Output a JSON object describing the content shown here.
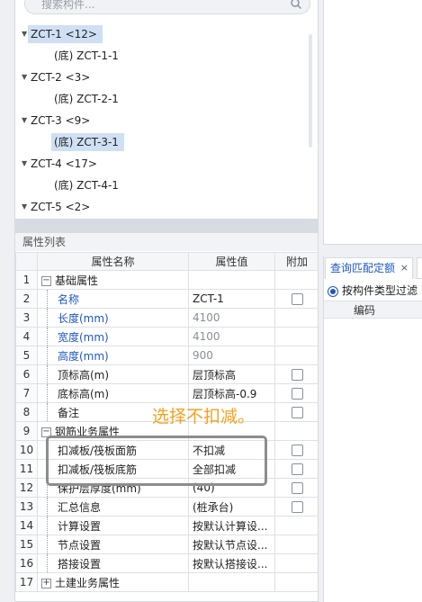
{
  "search": {
    "placeholder": "搜索构件..."
  },
  "tree": {
    "items": [
      {
        "label": "ZCT-1 <12>",
        "kind": "parent",
        "selected": true
      },
      {
        "label": "(底) ZCT-1-1",
        "kind": "child",
        "selected": false
      },
      {
        "label": "ZCT-2 <3>",
        "kind": "parent",
        "selected": false
      },
      {
        "label": "(底) ZCT-2-1",
        "kind": "child",
        "selected": false
      },
      {
        "label": "ZCT-3 <9>",
        "kind": "parent",
        "selected": false
      },
      {
        "label": "(底) ZCT-3-1",
        "kind": "child",
        "selected": true
      },
      {
        "label": "ZCT-4 <17>",
        "kind": "parent",
        "selected": false
      },
      {
        "label": "(底) ZCT-4-1",
        "kind": "child",
        "selected": false
      },
      {
        "label": "ZCT-5 <2>",
        "kind": "parent",
        "selected": false
      }
    ]
  },
  "props": {
    "title": "属性列表",
    "headers": {
      "name": "属性名称",
      "value": "属性值",
      "extra": "附加"
    },
    "rows": [
      {
        "num": "1",
        "name": "基础属性",
        "value": "",
        "group": true,
        "expander": "−"
      },
      {
        "num": "2",
        "name": "名称",
        "value": "ZCT-1",
        "blue": true,
        "check": true
      },
      {
        "num": "3",
        "name": "长度(mm)",
        "value": "4100",
        "blue": true,
        "readonly": true
      },
      {
        "num": "4",
        "name": "宽度(mm)",
        "value": "4100",
        "blue": true,
        "readonly": true
      },
      {
        "num": "5",
        "name": "高度(mm)",
        "value": "900",
        "blue": true,
        "readonly": true
      },
      {
        "num": "6",
        "name": "顶标高(m)",
        "value": "层顶标高",
        "check": true
      },
      {
        "num": "7",
        "name": "底标高(m)",
        "value": "层顶标高-0.9",
        "check": true
      },
      {
        "num": "8",
        "name": "备注",
        "value": "",
        "check": true
      },
      {
        "num": "9",
        "name": "钢筋业务属性",
        "value": "",
        "group": true,
        "expander": "−"
      },
      {
        "num": "10",
        "name": "扣减板/筏板面筋",
        "value": "不扣减",
        "check": true
      },
      {
        "num": "11",
        "name": "扣减板/筏板底筋",
        "value": "全部扣减",
        "check": true
      },
      {
        "num": "12",
        "name": "保护层厚度(mm)",
        "value": "(40)",
        "check": true
      },
      {
        "num": "13",
        "name": "汇总信息",
        "value": "(桩承台)",
        "check": true
      },
      {
        "num": "14",
        "name": "计算设置",
        "value": "按默认计算设..."
      },
      {
        "num": "15",
        "name": "节点设置",
        "value": "按默认节点设..."
      },
      {
        "num": "16",
        "name": "搭接设置",
        "value": "按默认搭接设..."
      },
      {
        "num": "17",
        "name": "土建业务属性",
        "value": "",
        "group": true,
        "expander": "+"
      }
    ]
  },
  "annotation": {
    "text": "选择不扣减。"
  },
  "right_panel": {
    "tab_label": "查询匹配定额",
    "tab_close": "×",
    "radio_label": "按构件类型过滤",
    "column_header": "编码"
  }
}
